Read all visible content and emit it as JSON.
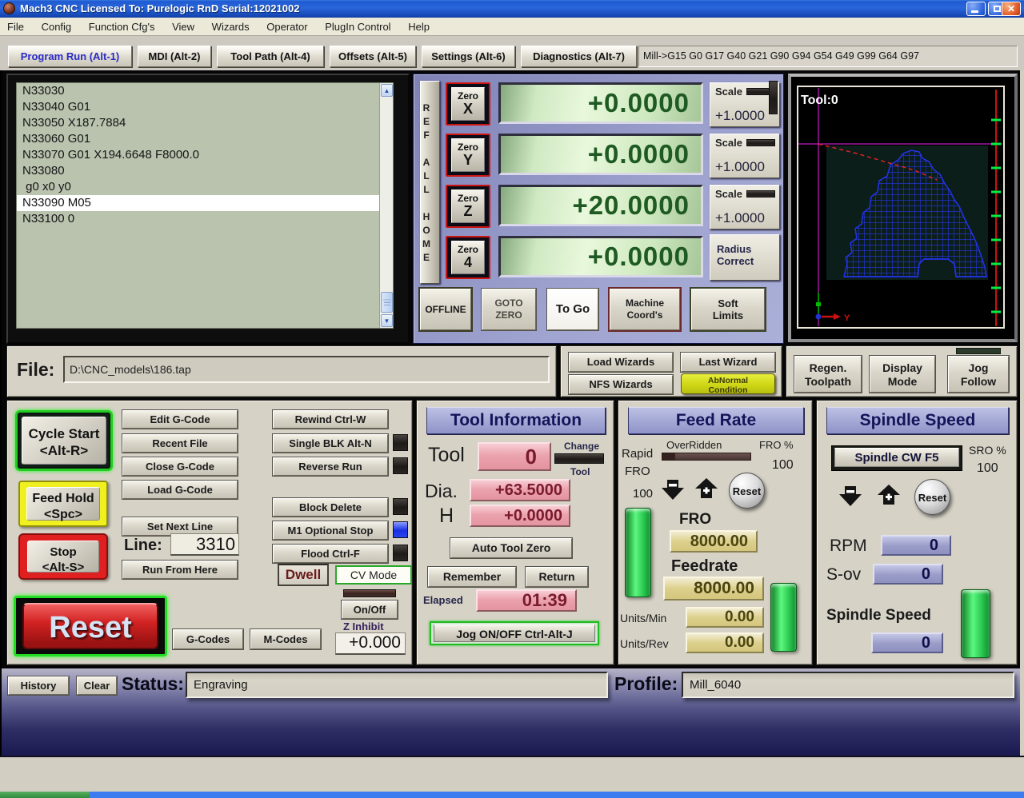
{
  "colors": {
    "titlebar_blue": "#2a66da",
    "panel_beige": "#d6d2c6",
    "dro_green_bg": "#d9efcb",
    "dro_green_text": "#1e5a22",
    "dro_pink": "#eba3ae",
    "dro_khaki": "#ddd08d",
    "dro_lavender": "#9a9cc8",
    "led_blue": "#2a44f0",
    "abnormal_yellow": "#ccd414",
    "toolpath_blue": "#2233ee",
    "crosshair_magenta": "#ee22ee",
    "slider_green": "#2ecc55"
  },
  "icons": {
    "scroll_up": "▲",
    "scroll_down": "▼",
    "close": "✕",
    "decrease": "-",
    "increase": "+"
  },
  "window": {
    "title": "Mach3 CNC  Licensed To: Purelogic RnD Serial:12021002"
  },
  "menu": {
    "items": [
      "File",
      "Config",
      "Function Cfg's",
      "View",
      "Wizards",
      "Operator",
      "PlugIn Control",
      "Help"
    ]
  },
  "tabs": {
    "items": [
      "Program Run (Alt-1)",
      "MDI (Alt-2)",
      "Tool Path (Alt-4)",
      "Offsets (Alt-5)",
      "Settings (Alt-6)",
      "Diagnostics (Alt-7)"
    ],
    "gcode_modes": "Mill->G15  G0 G17 G40 G21 G90 G94 G54 G49 G99 G64 G97"
  },
  "gcode_list": {
    "lines": [
      "N33030",
      "N33040 G01",
      "N33050 X187.7884",
      "N33060 G01",
      "N33070 G01 X194.6648 F8000.0",
      "N33080",
      " g0 x0 y0",
      "N33090 M05",
      "N33100 0"
    ],
    "highlighted_index": 7
  },
  "dro": {
    "ref_all_home": "REF ALL HOME",
    "zero_label": "Zero",
    "scale_label": "Scale",
    "axes": [
      {
        "letter": "X",
        "value": "+0.0000",
        "scale": "+1.0000"
      },
      {
        "letter": "Y",
        "value": "+0.0000",
        "scale": "+1.0000"
      },
      {
        "letter": "Z",
        "value": "+20.0000",
        "scale": "+1.0000"
      },
      {
        "letter": "4",
        "value": "+0.0000"
      }
    ],
    "radius_correct": "Radius\nCorrect",
    "buttons": {
      "offline": "OFFLINE",
      "goto_zero": "GOTO\nZERO",
      "to_go": "To Go",
      "machine_coords": "Machine\nCoord's",
      "soft_limits": "Soft\nLimits"
    }
  },
  "toolpath": {
    "tool_label": "Tool:0",
    "y_axis_label": "Y"
  },
  "file_bar": {
    "label": "File:",
    "value": "D:\\CNC_models\\186.tap"
  },
  "wizards": {
    "load": "Load Wizards",
    "last": "Last Wizard",
    "nfs": "NFS Wizards",
    "abnormal": "AbNormal\nCondition"
  },
  "view_controls": {
    "regen": "Regen.\nToolpath",
    "display": "Display\nMode",
    "jog": "Jog\nFollow"
  },
  "run": {
    "cycle_start": "Cycle Start\n<Alt-R>",
    "feed_hold": "Feed Hold\n<Spc>",
    "stop": "Stop\n<Alt-S>",
    "reset": "Reset",
    "edit": "Edit G-Code",
    "recent": "Recent File",
    "close": "Close G-Code",
    "load": "Load G-Code",
    "set_next": "Set Next Line",
    "line_label": "Line:",
    "line_value": "3310",
    "run_from_here": "Run From Here",
    "rewind": "Rewind Ctrl-W",
    "single_blk": "Single BLK Alt-N",
    "reverse": "Reverse Run",
    "block_delete": "Block Delete",
    "m1_stop": "M1 Optional Stop",
    "flood": "Flood Ctrl-F",
    "dwell": "Dwell",
    "cv_mode": "CV Mode",
    "gcodes": "G-Codes",
    "mcodes": "M-Codes",
    "onoff": "On/Off",
    "z_inhibit_label": "Z Inhibit",
    "z_inhibit_value": "+0.000"
  },
  "tool_info": {
    "title": "Tool Information",
    "tool_label": "Tool",
    "tool_value": "0",
    "change_label": "Change",
    "tool2_label": "Tool",
    "dia_label": "Dia.",
    "dia_value": "+63.5000",
    "h_label": "H",
    "h_value": "+0.0000",
    "auto_tool_zero": "Auto Tool Zero",
    "remember": "Remember",
    "return": "Return",
    "elapsed_label": "Elapsed",
    "elapsed_value": "01:39",
    "jog_button": "Jog ON/OFF Ctrl-Alt-J"
  },
  "feed": {
    "title": "Feed Rate",
    "overridden": "OverRidden",
    "fro_pct_label": "FRO %",
    "fro_pct": "100",
    "rapid_label1": "Rapid",
    "rapid_label2": "FRO",
    "rapid_value": "100",
    "reset": "Reset",
    "fro_label": "FRO",
    "fro_value": "8000.00",
    "feedrate_label": "Feedrate",
    "feedrate_value": "8000.00",
    "units_min_label": "Units/Min",
    "units_min": "0.00",
    "units_rev_label": "Units/Rev",
    "units_rev": "0.00"
  },
  "spindle": {
    "title": "Spindle Speed",
    "cw_button": "Spindle CW F5",
    "sro_label": "SRO %",
    "sro": "100",
    "reset": "Reset",
    "rpm_label": "RPM",
    "rpm": "0",
    "sov_label": "S-ov",
    "sov": "0",
    "speed_label": "Spindle Speed",
    "speed": "0"
  },
  "status_bar": {
    "history": "History",
    "clear": "Clear",
    "status_label": "Status:",
    "status_value": "Engraving",
    "profile_label": "Profile:",
    "profile_value": "Mill_6040"
  }
}
